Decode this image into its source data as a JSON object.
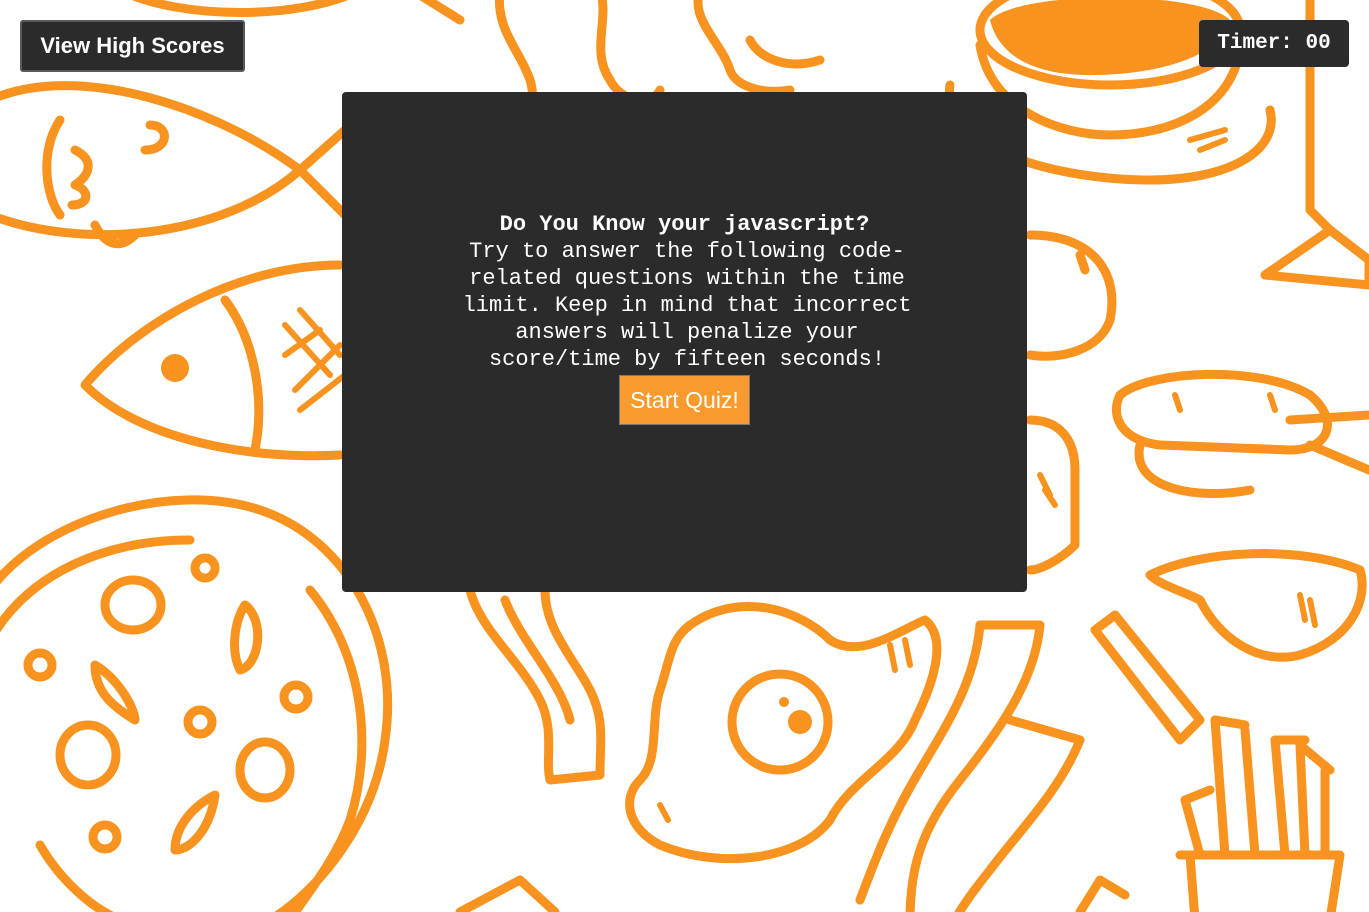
{
  "header": {
    "high_scores_label": "View High Scores",
    "timer_label": "Timer:",
    "timer_value": "00"
  },
  "intro": {
    "title": "Do You Know your javascript?",
    "description": "Try to answer the following code-related questions within the time limit. Keep in mind that incorrect answers will penalize your score/time by fifteen seconds!",
    "start_label": "Start Quiz!"
  },
  "colors": {
    "accent": "#f7931e",
    "panel": "#2b2b2b",
    "button": "#f99a2e",
    "text": "#ffffff"
  }
}
